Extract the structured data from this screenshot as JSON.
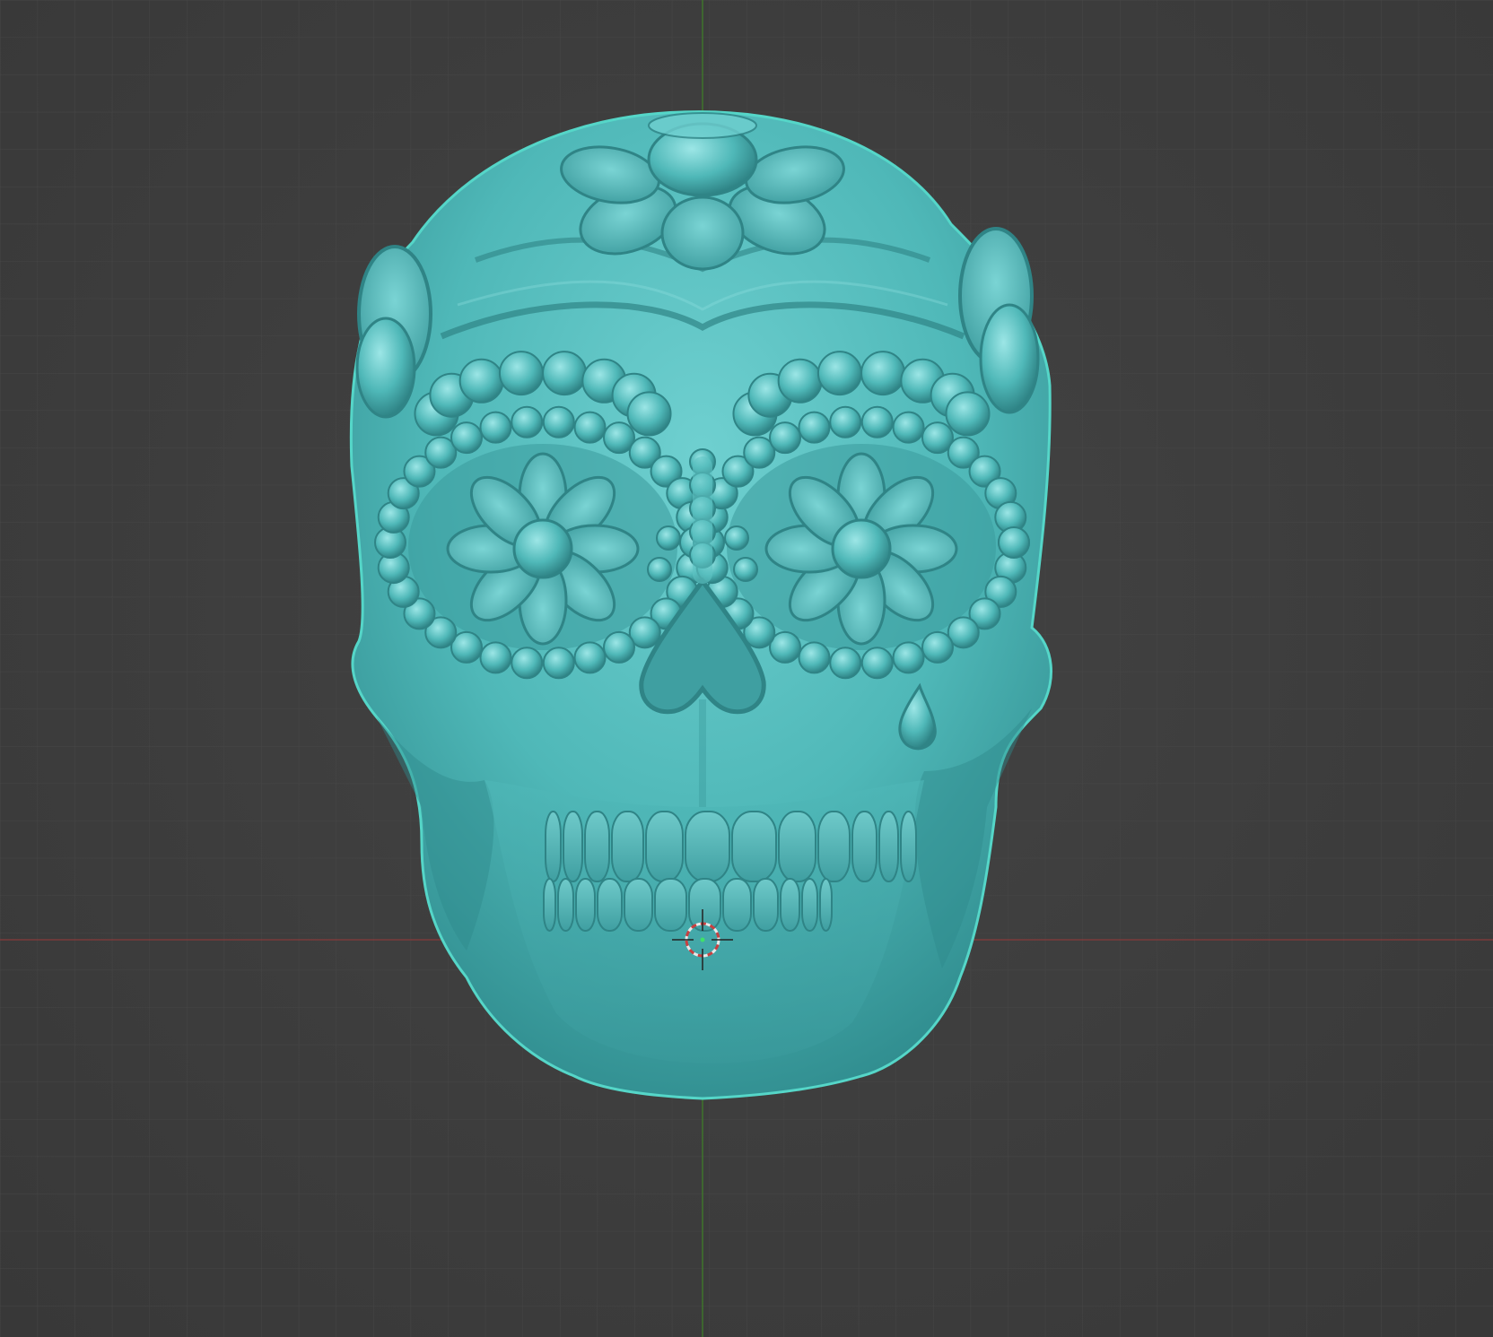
{
  "viewport": {
    "background_color": "#3d3d3d",
    "grid_color": "#4a4a4a",
    "x_axis_color": "#8a3a3a",
    "y_axis_color": "#3f7a2a"
  },
  "object": {
    "kind": "sculpted sugar skull mesh",
    "material_color": "#4fb8b8",
    "shadow_color": "#2e8a8c",
    "highlight_color": "#8fe0e0",
    "selection_outline_color": "#55d6c8"
  },
  "cursor": {
    "icon": "3d-cursor-icon"
  }
}
